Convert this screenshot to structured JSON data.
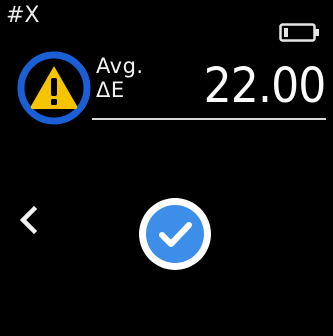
{
  "header": {
    "sample_id": "#X",
    "battery_icon": "battery-low-icon"
  },
  "measurement": {
    "warning_icon": "warning-triangle-icon",
    "label_line1": "Avg.",
    "label_line2": "ΔE",
    "value": "22.00"
  },
  "navigation": {
    "back_icon": "chevron-left-icon",
    "confirm_icon": "checkmark-circle-icon"
  },
  "colors": {
    "background": "#000000",
    "accent_blue": "#1a5fd6",
    "warning_yellow": "#f5c400",
    "confirm_blue": "#3d8ee8"
  }
}
